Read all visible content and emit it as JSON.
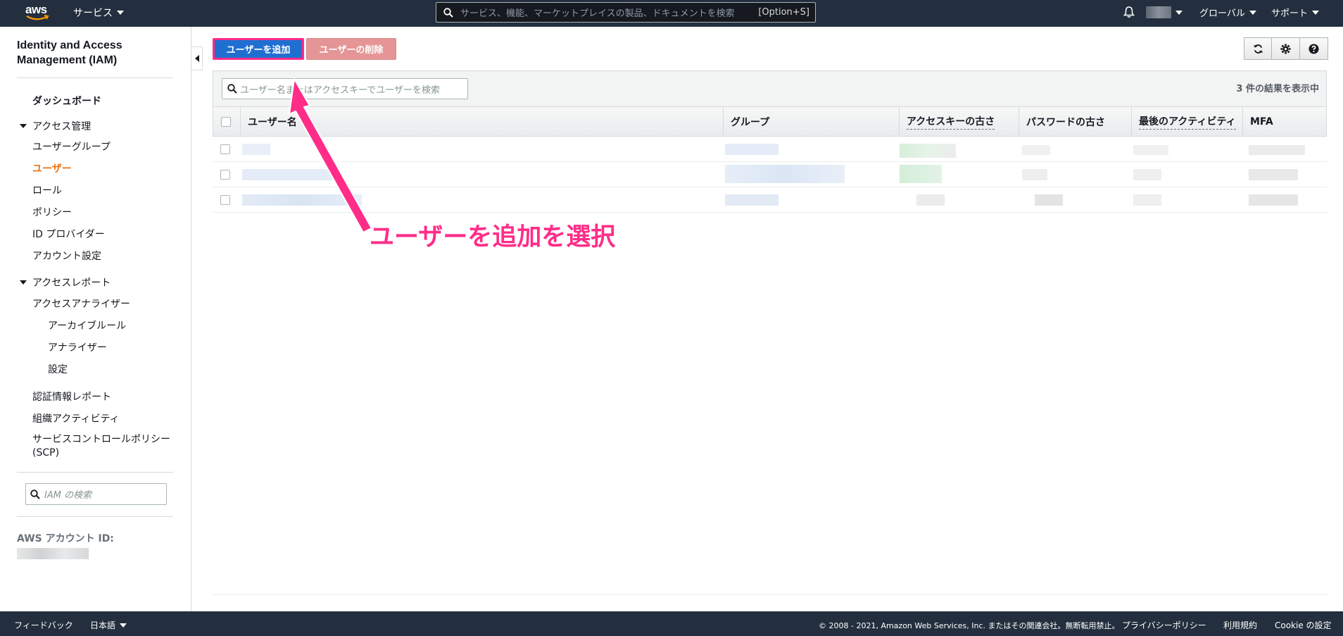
{
  "topnav": {
    "logo": "aws",
    "services_label": "サービス",
    "search_placeholder": "サービス、機能、マーケットプレイスの製品、ドキュメントを検索",
    "search_shortcut": "[Option+S]",
    "region_label": "グローバル",
    "support_label": "サポート"
  },
  "sidebar": {
    "title": "Identity and Access Management (IAM)",
    "dashboard": "ダッシュボード",
    "access_mgmt": {
      "label": "アクセス管理",
      "items": [
        "ユーザーグループ",
        "ユーザー",
        "ロール",
        "ポリシー",
        "ID プロバイダー",
        "アカウント設定"
      ]
    },
    "access_reports": {
      "label": "アクセスレポート",
      "analyzer": "アクセスアナライザー",
      "analyzer_items": [
        "アーカイブルール",
        "アナライザー",
        "設定"
      ],
      "items": [
        "認証情報レポート",
        "組織アクティビティ",
        "サービスコントロールポリシー (SCP)"
      ]
    },
    "search_placeholder": "IAM の検索",
    "account_id_label": "AWS アカウント ID:"
  },
  "main": {
    "add_user_button": "ユーザーを追加",
    "delete_user_button": "ユーザーの削除",
    "filter_placeholder": "ユーザー名またはアクセスキーでユーザーを検索",
    "result_count": "3 件の結果を表示中",
    "columns": [
      "ユーザー名",
      "グループ",
      "アクセスキーの古さ",
      "パスワードの古さ",
      "最後のアクティビティ",
      "MFA"
    ]
  },
  "annotation": "ユーザーを追加を選択",
  "footer": {
    "feedback": "フィードバック",
    "language": "日本語",
    "copyright": "© 2008 - 2021, Amazon Web Services, Inc. またはその関連会社。無断転用禁止。",
    "privacy": "プライバシーポリシー",
    "terms": "利用規約",
    "cookie": "Cookie の設定"
  },
  "colors": {
    "nav_bg": "#232f3e",
    "primary": "#1f6fd1",
    "danger_disabled": "#e59595",
    "active_nav": "#ec7211",
    "annotation": "#ff2d88"
  }
}
